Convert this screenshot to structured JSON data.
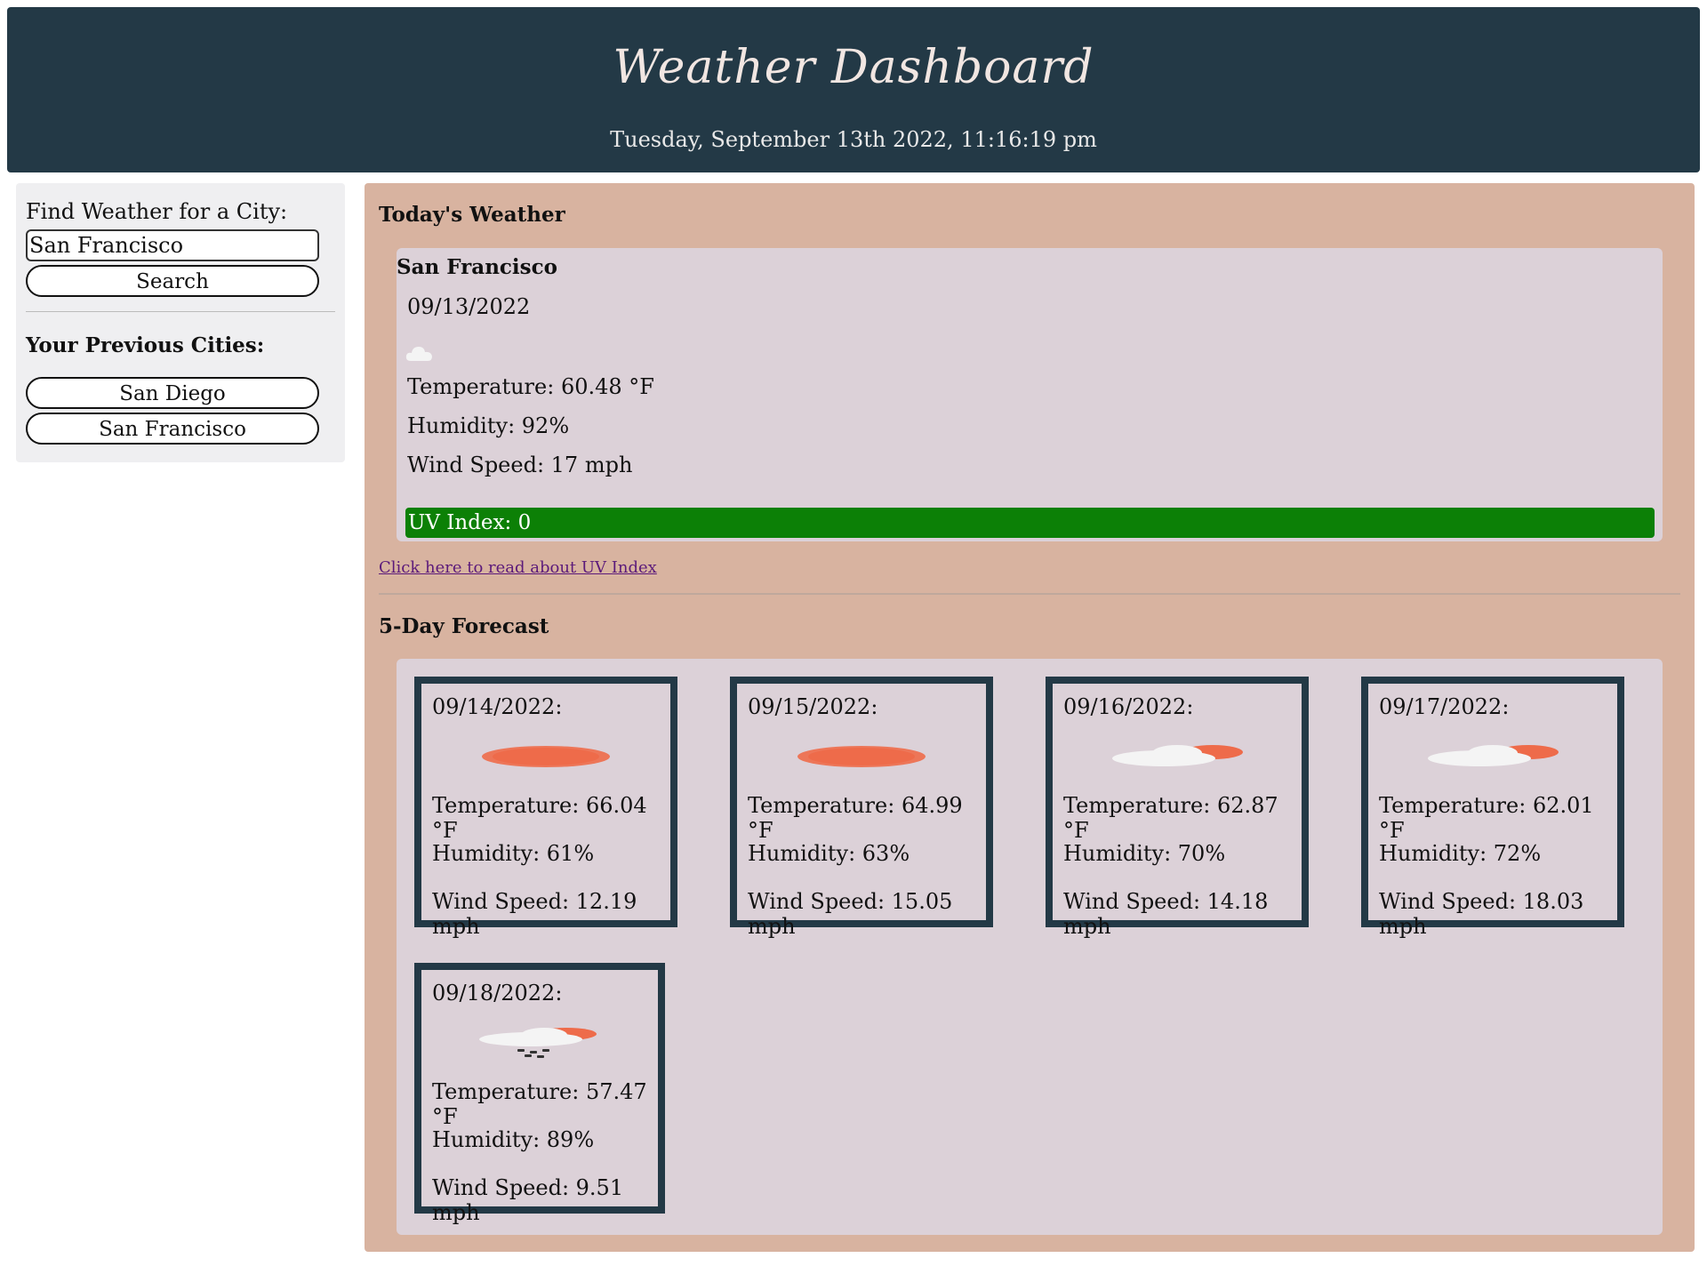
{
  "header": {
    "title": "Weather Dashboard",
    "datetime": "Tuesday, September 13th 2022, 11:16:19 pm"
  },
  "sidebar": {
    "find_label": "Find Weather for a City:",
    "search_value": "San Francisco",
    "search_button": "Search",
    "previous_title": "Your Previous Cities:",
    "previous_cities": [
      "San Diego",
      "San Francisco"
    ]
  },
  "today": {
    "section_title": "Today's Weather",
    "city": "San Francisco",
    "date": "09/13/2022",
    "icon": "cloud-icon",
    "temperature": "Temperature: 60.48 °F",
    "humidity": "Humidity: 92%",
    "wind": "Wind Speed: 17 mph",
    "uv": "UV Index: 0",
    "uv_color": "#0c8006",
    "uv_link": "Click here to read about UV Index"
  },
  "forecast": {
    "section_title": "5-Day Forecast",
    "days": [
      {
        "date": "09/14/2022:",
        "icon": "sun-haze-icon",
        "temperature": "Temperature: 66.04 °F",
        "humidity": "Humidity: 61%",
        "wind": "Wind Speed: 12.19 mph"
      },
      {
        "date": "09/15/2022:",
        "icon": "sun-haze-icon",
        "temperature": "Temperature: 64.99 °F",
        "humidity": "Humidity: 63%",
        "wind": "Wind Speed: 15.05 mph"
      },
      {
        "date": "09/16/2022:",
        "icon": "partly-cloudy-icon",
        "temperature": "Temperature: 62.87 °F",
        "humidity": "Humidity: 70%",
        "wind": "Wind Speed: 14.18 mph"
      },
      {
        "date": "09/17/2022:",
        "icon": "partly-cloudy-icon",
        "temperature": "Temperature: 62.01 °F",
        "humidity": "Humidity: 72%",
        "wind": "Wind Speed: 18.03 mph"
      },
      {
        "date": "09/18/2022:",
        "icon": "rain-sun-icon",
        "temperature": "Temperature: 57.47 °F",
        "humidity": "Humidity: 89%",
        "wind": "Wind Speed: 9.51 mph"
      }
    ]
  },
  "colors": {
    "header_bg": "#233946",
    "main_bg": "#d8b3a0",
    "card_bg": "#dcd1d8",
    "sun_color": "#ee6b4a"
  }
}
